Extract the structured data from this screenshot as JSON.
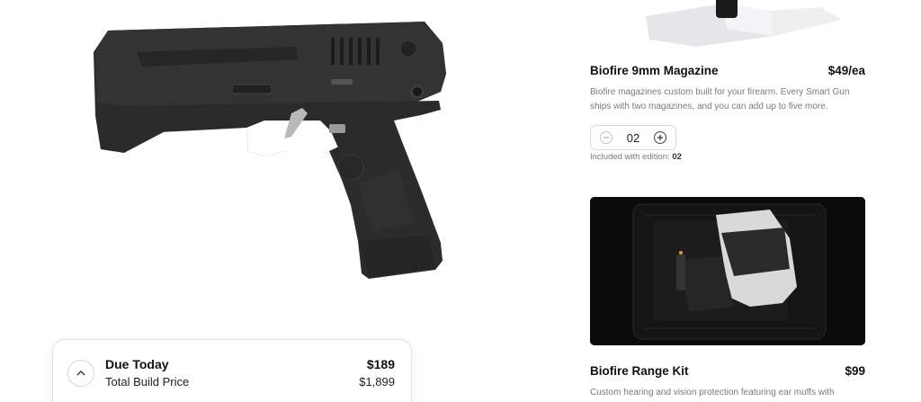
{
  "summary": {
    "due_label": "Due Today",
    "due_value": "$189",
    "total_label": "Total Build Price",
    "total_value": "$1,899"
  },
  "magazine": {
    "title": "Biofire 9mm Magazine",
    "price": "$49/ea",
    "description": "Biofire magazines custom built for your firearm. Every Smart Gun ships with two magazines, and you can add up to five more.",
    "quantity": "02",
    "included_label": "Included with edition:",
    "included_value": "02"
  },
  "range_kit": {
    "title": "Biofire Range Kit",
    "price": "$99",
    "description": "Custom hearing and vision protection featuring ear muffs with"
  },
  "icons": {
    "toggle": "chevron-up-icon",
    "decrement": "minus-circle-icon",
    "increment": "plus-circle-icon"
  },
  "colors": {
    "gun_body": "#2b2b2b",
    "case_bg": "#0b0b0b",
    "muted_text": "#7a7a7a"
  }
}
